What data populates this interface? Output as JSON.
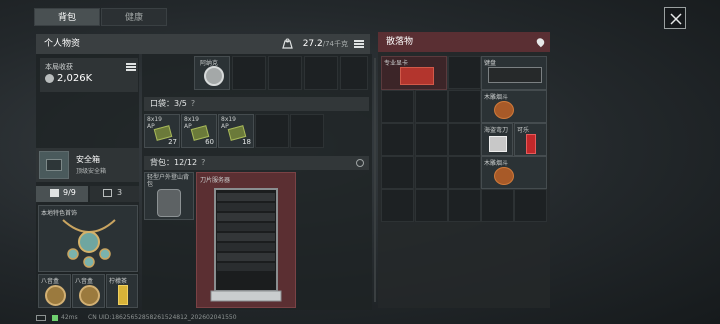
{
  "tabs": [
    {
      "label": "背包",
      "active": true
    },
    {
      "label": "健康",
      "active": false
    }
  ],
  "personal": {
    "title": "个人物资",
    "weight_current": "27.2",
    "weight_max": "/74千克"
  },
  "session_income": {
    "label": "本局收获",
    "value": "2,026K"
  },
  "safe_box": {
    "name": "安全箱",
    "grade": "顶级安全箱"
  },
  "sub_tabs": {
    "slots": "9/9",
    "count": "3"
  },
  "left_items": {
    "necklace_label": "本地特色首饰",
    "item_a": "八音盒",
    "item_b": "八音盒",
    "item_c": "柠檬茶"
  },
  "top_strip": {
    "item_label": "阿纳克"
  },
  "pocket": {
    "label": "口袋：",
    "count": "3/5",
    "help": "?",
    "ammo": [
      {
        "label": "8x19",
        "sub": "AP",
        "qty": "27"
      },
      {
        "label": "8x19",
        "sub": "AP",
        "qty": "60"
      },
      {
        "label": "8x19",
        "sub": "AP",
        "qty": "18"
      }
    ]
  },
  "backpack": {
    "label": "背包：",
    "count": "12/12",
    "help": "?",
    "bag_label": "轻型户外登山背包",
    "server_label": "刀片服务器"
  },
  "loot": {
    "title": "散落物",
    "items": {
      "gpu": "专业显卡",
      "keyboard": "键盘",
      "pipe1": "木雕烟斗",
      "pipe2": "木雕烟斗",
      "cassette": "海盗弯刀",
      "can": "可乐"
    }
  },
  "status": {
    "ping": "42ms",
    "uid": "CN UID:1862565285826152481​2_202602041550"
  },
  "colors": {
    "loot_header": "#5a2f33",
    "server_bg": "#5b2f32"
  }
}
